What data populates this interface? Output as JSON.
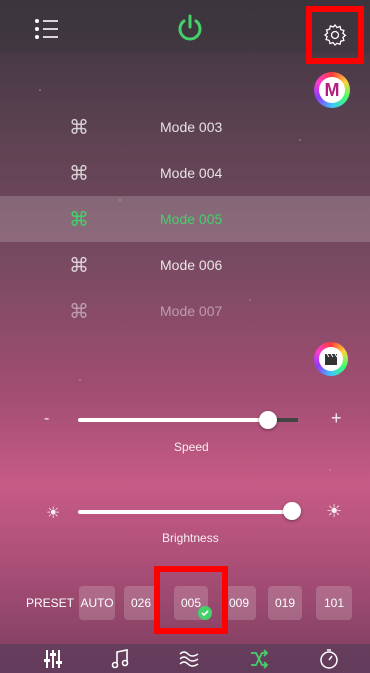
{
  "topbar": {
    "menu_icon": "list-icon",
    "power_icon": "power-icon",
    "settings_icon": "gear-icon",
    "accent": "#44d16a"
  },
  "mode_badge": {
    "letter": "M"
  },
  "modes": [
    {
      "label": "Mode 003",
      "icon": "command-icon"
    },
    {
      "label": "Mode 004",
      "icon": "command-icon"
    },
    {
      "label": "Mode 005",
      "icon": "command-icon",
      "selected": true
    },
    {
      "label": "Mode 006",
      "icon": "command-icon"
    },
    {
      "label": "Mode 007",
      "icon": "command-icon"
    }
  ],
  "speed": {
    "minus": "-",
    "plus": "+",
    "label": "Speed",
    "level": 0.87
  },
  "brightness": {
    "label": "Brightness",
    "level": 1.0
  },
  "preset": {
    "label": "PRESET",
    "items": [
      "AUTO",
      "026",
      "005",
      "009",
      "019",
      "101"
    ],
    "selected": "005"
  },
  "bottom_nav": [
    "sliders-icon",
    "music-note-icon",
    "wave-icon",
    "shuffle-icon",
    "timer-icon"
  ]
}
